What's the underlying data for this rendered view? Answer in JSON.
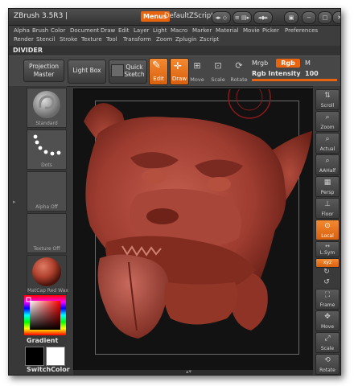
{
  "window": {
    "app_title": "ZBrush 3.5R3 |",
    "menus_label": "Menus",
    "script_name": "DefaultZScript",
    "title_icons": [
      "◂▸ ◇",
      "≡ ▤▸",
      "◂◆▸",
      "▣",
      "−",
      "□",
      "✕"
    ]
  },
  "menubar": {
    "row1": [
      "Alpha",
      "Brush",
      "Color",
      "Document",
      "Draw",
      "Edit",
      "Layer",
      "Light",
      "Macro",
      "Marker",
      "Material",
      "Movie",
      "Picker",
      "Preferences"
    ],
    "row2": [
      "Render",
      "Stencil",
      "Stroke",
      "Texture",
      "Tool",
      "Transform",
      "Zoom",
      "Zplugin",
      "Zscript"
    ]
  },
  "divider_label": "DIVIDER",
  "toolbar": {
    "projection_master": "Projection Master",
    "light_box": "Light Box",
    "quick_sketch": "Quick Sketch",
    "edit": "Edit",
    "draw": "Draw",
    "move": "Move",
    "scale": "Scale",
    "rotate": "Rotate",
    "mrgb": "Mrgb",
    "rgb": "Rgb",
    "m": "M",
    "rgb_intensity_label": "Rgb Intensity",
    "rgb_intensity_value": "100"
  },
  "left_panel": {
    "brush_label": "Standard",
    "stroke_label": "Dots",
    "alpha_label": "Alpha Off",
    "texture_label": "Texture Off",
    "material_label": "MatCap Red Wax",
    "gradient_label": "Gradient",
    "switch_color_label": "SwitchColor"
  },
  "right_panel": {
    "buttons": [
      "Scroll",
      "Zoom",
      "Actual",
      "AAHalf",
      "Persp",
      "Floor",
      "Local",
      "L.Sym",
      "xyz",
      "",
      "",
      "Frame",
      "Move",
      "Scale",
      "Rotate",
      ""
    ]
  },
  "colors": {
    "accent": "#e8640e",
    "viewport_bg": "#121212",
    "sculpt": "#a5463b"
  }
}
